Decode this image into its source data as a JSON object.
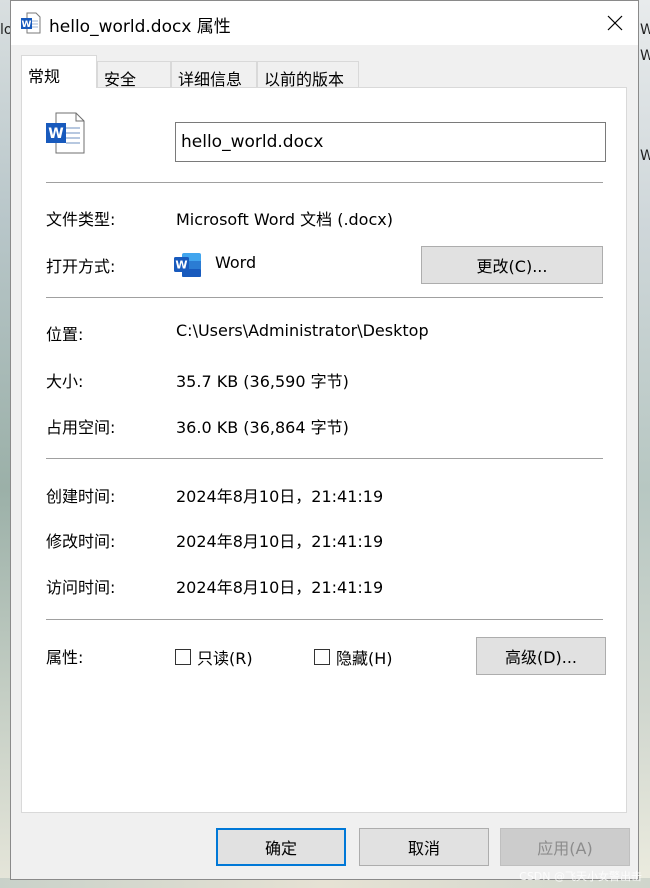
{
  "window": {
    "title": "hello_world.docx 属性",
    "close_glyph": "✕"
  },
  "background_fragments": [
    "lo",
    "W",
    "W",
    "W"
  ],
  "tabs": [
    {
      "label": "常规",
      "active": true
    },
    {
      "label": "安全",
      "active": false
    },
    {
      "label": "详细信息",
      "active": false
    },
    {
      "label": "以前的版本",
      "active": false
    }
  ],
  "general": {
    "filename": "hello_world.docx",
    "file_type_label": "文件类型:",
    "file_type_value": "Microsoft Word 文档 (.docx)",
    "opens_with_label": "打开方式:",
    "opens_with_value": "Word",
    "change_button": "更改(C)...",
    "location_label": "位置:",
    "location_value": "C:\\Users\\Administrator\\Desktop",
    "size_label": "大小:",
    "size_value": "35.7 KB (36,590 字节)",
    "size_on_disk_label": "占用空间:",
    "size_on_disk_value": "36.0 KB (36,864 字节)",
    "created_label": "创建时间:",
    "created_value": "2024年8月10日，21:41:19",
    "modified_label": "修改时间:",
    "modified_value": "2024年8月10日，21:41:19",
    "accessed_label": "访问时间:",
    "accessed_value": "2024年8月10日，21:41:19",
    "attributes_label": "属性:",
    "readonly_label": "只读(R)",
    "readonly_checked": false,
    "hidden_label": "隐藏(H)",
    "hidden_checked": false,
    "advanced_button": "高级(D)..."
  },
  "footer": {
    "ok": "确定",
    "cancel": "取消",
    "apply": "应用(A)"
  },
  "watermark": "CSDN @飞天小女警出击",
  "colors": {
    "word_blue": "#185abd",
    "focus_blue": "#0078d7"
  }
}
